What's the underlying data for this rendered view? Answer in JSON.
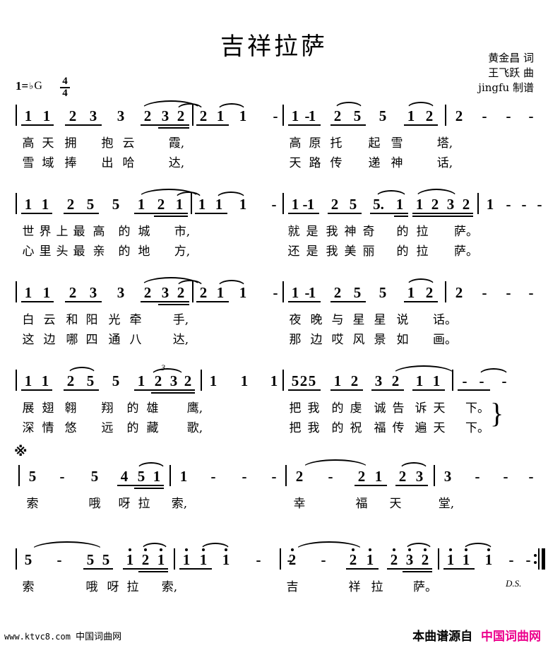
{
  "header": {
    "title": "吉祥拉萨",
    "credits": [
      "黄金昌 词",
      "王飞跃 曲",
      "jingfu 制谱"
    ],
    "key_prefix": "1=",
    "key_accidental": "♭",
    "key_name": "G",
    "meter_top": "4",
    "meter_bottom": "4"
  },
  "marks": {
    "segno": "※",
    "ds": "D.S.",
    "triplet": "3"
  },
  "systems": [
    {
      "id": "system-1",
      "notes": [
        "1",
        "1",
        "2",
        "3",
        "3",
        "2",
        "3",
        "2",
        "2",
        "1",
        "1",
        "-",
        "-",
        "1",
        "1",
        "2",
        "5",
        "5",
        "1",
        "2",
        "2",
        "-",
        "-",
        "-"
      ],
      "lyrics_a": [
        "高",
        "天",
        "拥",
        "抱",
        "云",
        "霞,",
        "高",
        "原",
        "托",
        "起",
        "雪",
        "塔,"
      ],
      "lyrics_b": [
        "雪",
        "域",
        "捧",
        "出",
        "哈",
        "达,",
        "天",
        "路",
        "传",
        "递",
        "神",
        "话,"
      ]
    },
    {
      "id": "system-2",
      "notes": [
        "1",
        "1",
        "2",
        "5",
        "5",
        "1",
        "2",
        "1",
        "1",
        "1",
        "1",
        "-",
        "-",
        "1",
        "1",
        "2",
        "5",
        "5.",
        "1",
        "1",
        "2",
        "3",
        "2",
        "1",
        "-",
        "-",
        "-"
      ],
      "lyrics_a": [
        "世",
        "界",
        "上",
        "最",
        "高",
        "的",
        "城",
        "市,",
        "就",
        "是",
        "我",
        "神",
        "奇",
        "的",
        "拉",
        "萨。"
      ],
      "lyrics_b": [
        "心",
        "里",
        "头",
        "最",
        "亲",
        "的",
        "地",
        "方,",
        "还",
        "是",
        "我",
        "美",
        "丽",
        "的",
        "拉",
        "萨。"
      ]
    },
    {
      "id": "system-3",
      "notes": [
        "1",
        "1",
        "2",
        "3",
        "3",
        "2",
        "3",
        "2",
        "2",
        "1",
        "1",
        "-",
        "-",
        "1",
        "1",
        "2",
        "5",
        "5",
        "1",
        "2",
        "2",
        "-",
        "-",
        "-"
      ],
      "lyrics_a": [
        "白",
        "云",
        "和",
        "阳",
        "光",
        "牵",
        "手,",
        "夜",
        "晚",
        "与",
        "星",
        "星",
        "说",
        "话。"
      ],
      "lyrics_b": [
        "这",
        "边",
        "哪",
        "四",
        "通",
        "八",
        "达,",
        "那",
        "边",
        "哎",
        "风",
        "景",
        "如",
        "画。"
      ]
    },
    {
      "id": "system-4",
      "notes": [
        "1",
        "1",
        "2",
        "5",
        "5",
        "1",
        "2",
        "3",
        "2",
        "1",
        "1",
        "1",
        "2",
        "5",
        "5",
        "1",
        "2",
        "3",
        "2",
        "1",
        "1",
        "-",
        "-"
      ],
      "lyrics_a": [
        "展",
        "翅",
        "翱",
        "翔",
        "的",
        "雄",
        "鹰,",
        "把",
        "我",
        "的",
        "虔",
        "诚",
        "告",
        "诉",
        "天",
        "下。"
      ],
      "lyrics_b": [
        "深",
        "情",
        "悠",
        "远",
        "的",
        "藏",
        "歌,",
        "把",
        "我",
        "的",
        "祝",
        "福",
        "传",
        "遍",
        "天",
        "下。"
      ]
    },
    {
      "id": "system-5",
      "notes": [
        "5",
        "-",
        "5",
        "4",
        "5",
        "1",
        "1",
        "-",
        "-",
        "-",
        "2",
        "-",
        "2",
        "1",
        "2",
        "3",
        "3",
        "-",
        "-",
        "-"
      ],
      "lyrics_a": [
        "索",
        "哦",
        "呀",
        "拉",
        "索,",
        "幸",
        "福",
        "天",
        "堂,"
      ]
    },
    {
      "id": "system-6",
      "notes": [
        "5",
        "-",
        "5",
        "5",
        "1",
        "2",
        "1",
        "1",
        "1",
        "1",
        "-",
        "-",
        "2",
        "-",
        "2",
        "1",
        "2",
        "3",
        "2",
        "1",
        "1",
        "1",
        "-",
        "-"
      ],
      "lyrics_a": [
        "索",
        "哦",
        "呀",
        "拉",
        "索,",
        "吉",
        "祥",
        "拉",
        "萨。"
      ]
    }
  ],
  "footer": {
    "left_url": "www.ktvc8.com",
    "left_site": "中国词曲网",
    "right_prefix": "本曲谱源自",
    "right_brand": "中国词曲网",
    "brand_color": "#ec008c"
  }
}
